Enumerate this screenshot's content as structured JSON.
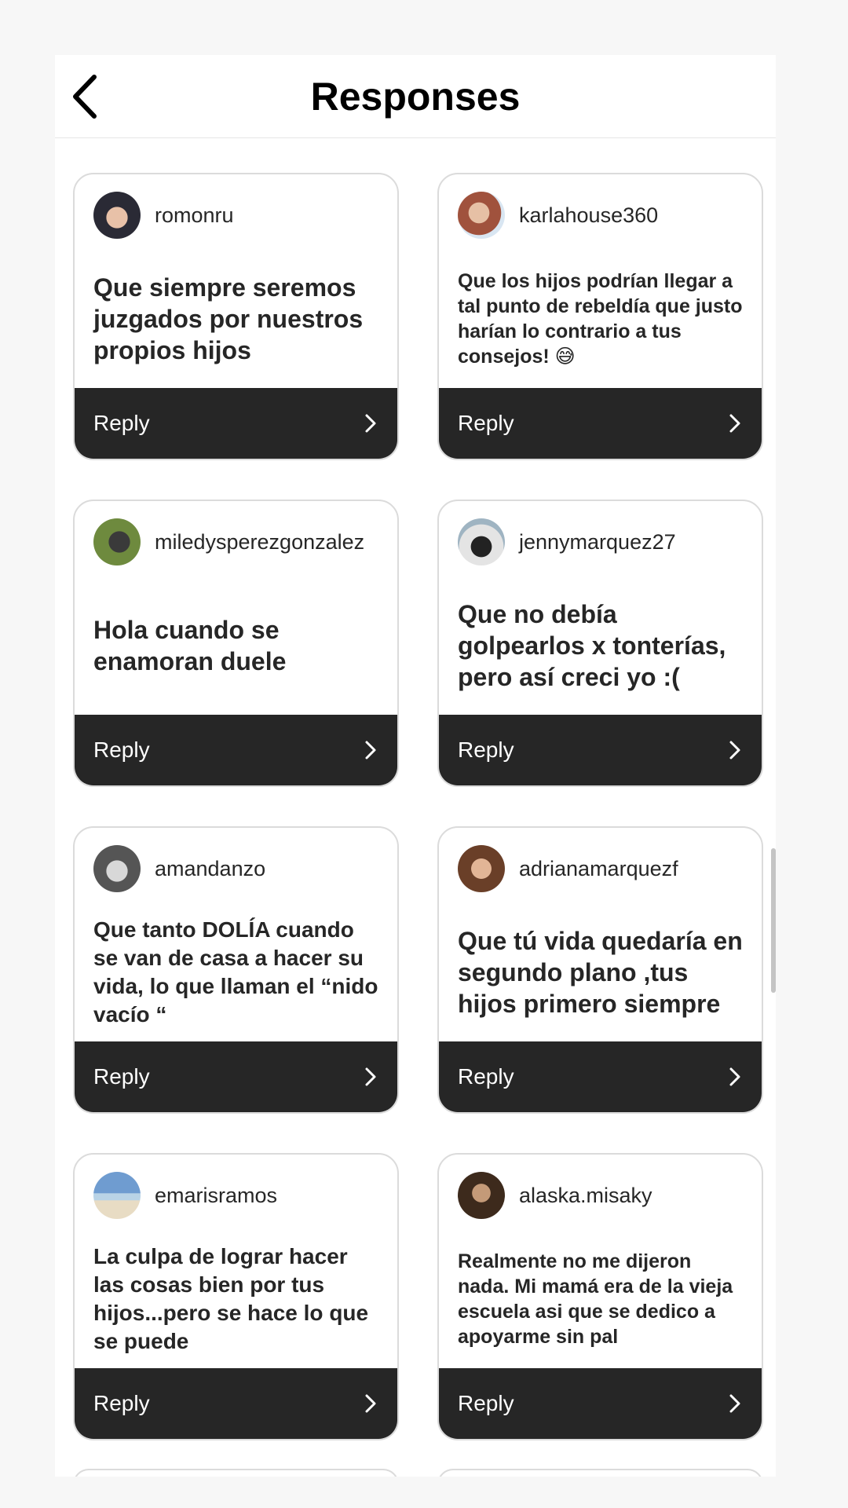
{
  "header": {
    "title": "Responses"
  },
  "responses": [
    {
      "username": "romonru",
      "text": "Que siempre seremos juzgados por nuestros propios hijos",
      "reply_label": "Reply",
      "avatar_color": "#3a3a4a"
    },
    {
      "username": "karlahouse360",
      "text": "Que los hijos podrían llegar a tal punto de rebeldía que justo harían lo contrario a tus consejos! 😅",
      "reply_label": "Reply",
      "avatar_color": "#9d6b58"
    },
    {
      "username": "miledysperezgonzalez",
      "text": "Hola cuando se enamoran duele",
      "reply_label": "Reply",
      "avatar_color": "#5f7a3e"
    },
    {
      "username": "jennymarquez27",
      "text": "Que no debía golpearlos x tonterías, pero así creci yo :(",
      "reply_label": "Reply",
      "avatar_color": "#7a8a95"
    },
    {
      "username": "amandanzo",
      "text": "Que tanto DOLÍA cuando se van de casa a hacer su vida, lo que llaman el “nido vacío “",
      "reply_label": "Reply",
      "avatar_color": "#6b6b6b"
    },
    {
      "username": "adrianamarquezf",
      "text": "Que tú vida quedaría en segundo plano ,tus hijos primero siempre",
      "reply_label": "Reply",
      "avatar_color": "#8a5a40"
    },
    {
      "username": "emarisramos",
      "text": "La culpa de lograr hacer las cosas bien por tus hijos...pero se hace lo que se puede",
      "reply_label": "Reply",
      "avatar_color": "#7fa6cf"
    },
    {
      "username": "alaska.misaky",
      "text": "Realmente no me dijeron nada. Mi mamá era de la vieja escuela asi que se dedico a apoyarme sin pal",
      "reply_label": "Reply",
      "avatar_color": "#4a3a2a"
    }
  ]
}
